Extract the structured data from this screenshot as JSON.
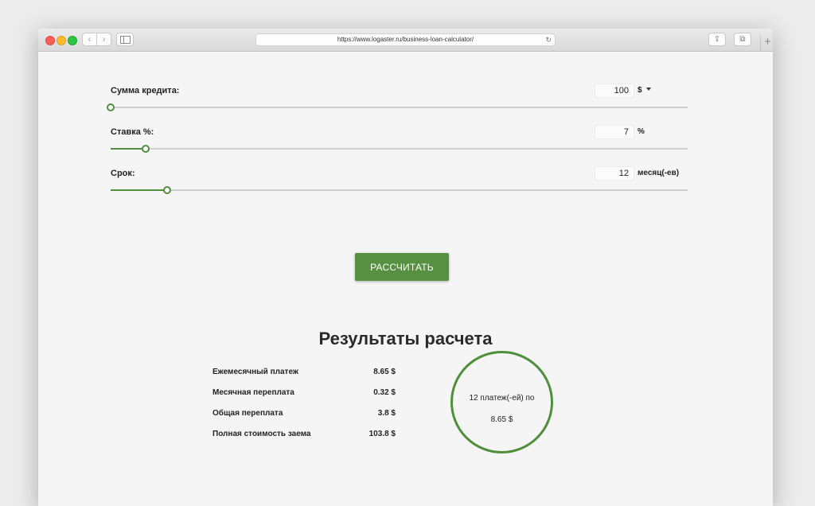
{
  "browser": {
    "url": "https://www.logaster.ru/business-loan-calculator/",
    "reload_glyph": "↻",
    "back_glyph": "‹",
    "forward_glyph": "›",
    "share_glyph": "⇪",
    "tabs_glyph": "⧉",
    "new_tab_glyph": "+"
  },
  "form": {
    "amount": {
      "label": "Сумма кредита:",
      "value": "100",
      "unit": "$",
      "slider_fraction": 0.0
    },
    "rate": {
      "label": "Ставка %:",
      "value": "7",
      "unit": "%",
      "slider_fraction": 0.06
    },
    "term": {
      "label": "Срок:",
      "value": "12",
      "unit": "месяц(-ев)",
      "slider_fraction": 0.098
    }
  },
  "calculate_button": "РАССЧИТАТЬ",
  "results": {
    "title": "Результаты расчета",
    "rows": [
      {
        "label": "Ежемесячный платеж",
        "value": "8.65 $"
      },
      {
        "label": "Месячная переплата",
        "value": "0.32 $"
      },
      {
        "label": "Общая переплата",
        "value": "3.8 $"
      },
      {
        "label": "Полная стоимость заема",
        "value": "103.8 $"
      }
    ],
    "summary_line1": "12 платеж(-ей) по",
    "summary_line2": "8.65 $"
  },
  "colors": {
    "accent": "#579040",
    "track": "#cfcfcf"
  }
}
